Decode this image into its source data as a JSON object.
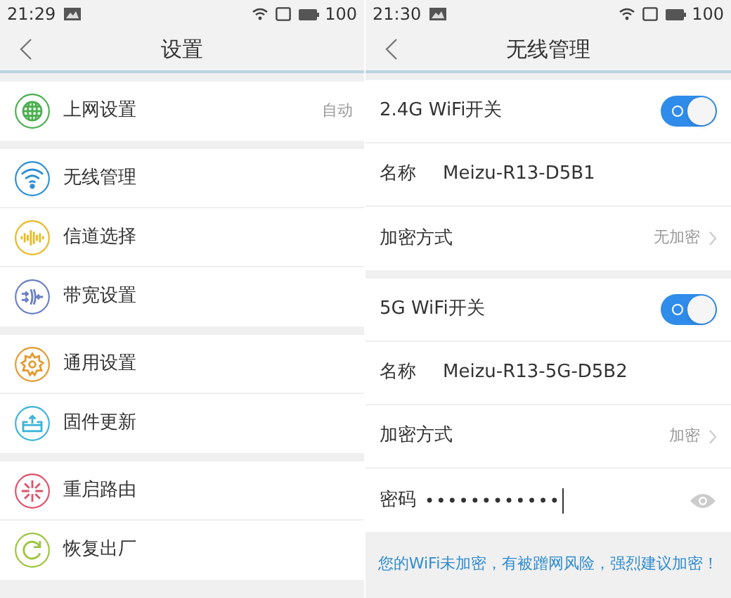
{
  "left_screen": {
    "status_bar": {
      "time": "21:29",
      "battery": "100"
    },
    "title": "设置",
    "groups": [
      {
        "items": [
          {
            "label": "上网设置",
            "value": "自动",
            "color": "#4caf50"
          }
        ]
      },
      {
        "items": [
          {
            "label": "无线管理",
            "color": "#2d8fd5"
          },
          {
            "label": "信道选择",
            "color": "#e8b923"
          },
          {
            "label": "带宽设置",
            "color": "#6b7fc4"
          }
        ]
      },
      {
        "items": [
          {
            "label": "通用设置",
            "color": "#e49a2e"
          },
          {
            "label": "固件更新",
            "color": "#3cb4d8"
          }
        ]
      },
      {
        "items": [
          {
            "label": "重启路由",
            "color": "#e0506a"
          },
          {
            "label": "恢复出厂",
            "color": "#9bc53d"
          }
        ]
      }
    ]
  },
  "right_screen": {
    "status_bar": {
      "time": "21:30",
      "battery": "100"
    },
    "title": "无线管理",
    "groups": [
      {
        "rows": [
          {
            "kind": "toggle",
            "label": "2.4G WiFi开关",
            "on": true
          },
          {
            "kind": "field",
            "label": "名称",
            "value": "Meizu-R13-D5B1"
          },
          {
            "kind": "select",
            "label": "加密方式",
            "value": "无加密"
          }
        ]
      },
      {
        "rows": [
          {
            "kind": "toggle",
            "label": "5G WiFi开关",
            "on": true
          },
          {
            "kind": "field",
            "label": "名称",
            "value": "Meizu-R13-5G-D5B2"
          },
          {
            "kind": "select",
            "label": "加密方式",
            "value": "加密"
          },
          {
            "kind": "password",
            "label": "密码",
            "value": "••••••••••••"
          }
        ]
      }
    ],
    "warning": "您的WiFi未加密，有被蹭网风险，强烈建议加密！"
  }
}
